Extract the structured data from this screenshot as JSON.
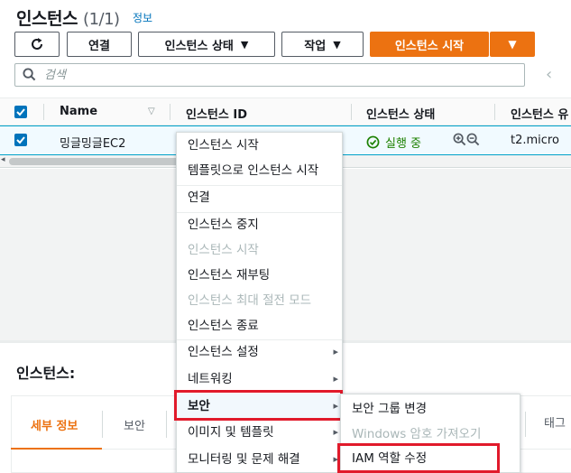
{
  "header": {
    "title": "인스턴스",
    "count": "(1/1)",
    "info_link": "정보"
  },
  "toolbar": {
    "connect": "연결",
    "instance_state": "인스턴스 상태",
    "actions": "작업",
    "launch": "인스턴스 시작"
  },
  "search": {
    "placeholder": "검색"
  },
  "table": {
    "columns": [
      "Name",
      "인스턴스 ID",
      "인스턴스 상태",
      "인스턴스 유"
    ],
    "row": {
      "name": "밍글밍글EC2",
      "state": "실행 중",
      "type": "t2.micro"
    }
  },
  "context_menu": {
    "items": [
      {
        "label": "인스턴스 시작",
        "disabled": false,
        "submenu": false
      },
      {
        "label": "템플릿으로 인스턴스 시작",
        "disabled": false,
        "submenu": false
      },
      {
        "label": "연결",
        "disabled": false,
        "submenu": false
      },
      {
        "label": "인스턴스 중지",
        "disabled": false,
        "submenu": false
      },
      {
        "label": "인스턴스 시작",
        "disabled": true,
        "submenu": false
      },
      {
        "label": "인스턴스 재부팅",
        "disabled": false,
        "submenu": false
      },
      {
        "label": "인스턴스 최대 절전 모드",
        "disabled": true,
        "submenu": false
      },
      {
        "label": "인스턴스 종료",
        "disabled": false,
        "submenu": false
      },
      {
        "label": "인스턴스 설정",
        "disabled": false,
        "submenu": true
      },
      {
        "label": "네트워킹",
        "disabled": false,
        "submenu": true
      },
      {
        "label": "보안",
        "disabled": false,
        "submenu": true
      },
      {
        "label": "이미지 및 템플릿",
        "disabled": false,
        "submenu": true
      },
      {
        "label": "모니터링 및 문제 해결",
        "disabled": false,
        "submenu": true
      }
    ]
  },
  "security_submenu": {
    "items": [
      {
        "label": "보안 그룹 변경",
        "disabled": false
      },
      {
        "label": "Windows 암호 가져오기",
        "disabled": true
      },
      {
        "label": "IAM 역할 수정",
        "disabled": false
      }
    ]
  },
  "details_pane": {
    "title": "인스턴스:",
    "tabs": [
      "세부 정보",
      "보안",
      "태그"
    ]
  },
  "colors": {
    "accent": "#ec7211",
    "link": "#0073bb",
    "running": "#1d8102",
    "highlight": "#e11a2b"
  }
}
